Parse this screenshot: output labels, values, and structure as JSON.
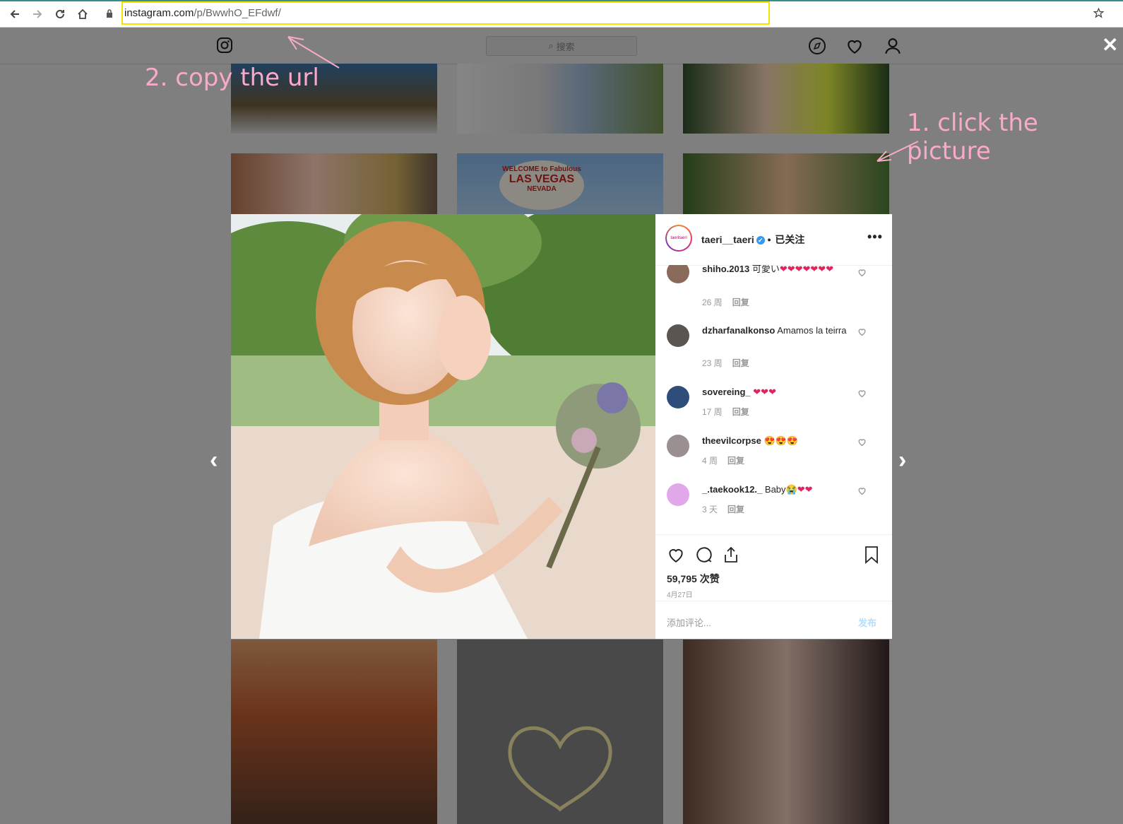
{
  "browser": {
    "url_host": "instagram.com",
    "url_path": "/p/BwwhO_EFdwf/",
    "nav_icons": [
      "back-icon",
      "forward-icon",
      "reload-icon",
      "home-icon",
      "lock-icon",
      "star-icon"
    ]
  },
  "instagram": {
    "search_placeholder": "搜索",
    "header_icons": [
      "instagram-logo",
      "explore-icon",
      "heart-icon",
      "profile-icon",
      "close-icon"
    ]
  },
  "post": {
    "username": "taeri__taeri",
    "follow_label": "已关注",
    "avatar_text": "taeritaeri",
    "comments": [
      {
        "user": "shiho.2013",
        "text": "可愛い",
        "emoji": "❤❤❤❤❤❤❤",
        "age": "26 周",
        "reply": "回复"
      },
      {
        "user": "dzharfanalkonso",
        "text": "Amamos la teirra",
        "emoji": "",
        "age": "23 周",
        "reply": "回复"
      },
      {
        "user": "sovereing_",
        "text": "",
        "emoji": "❤❤❤",
        "age": "17 周",
        "reply": "回复"
      },
      {
        "user": "theevilcorpse",
        "text": "",
        "emoji": "😍😍😍",
        "age": "4 周",
        "reply": "回复"
      },
      {
        "user": "_.taekook12._",
        "text": "Baby",
        "emoji": "😭❤❤",
        "age": "3 天",
        "reply": "回复"
      }
    ],
    "likes": "59,795 次赞",
    "date": "4月27日",
    "add_comment_placeholder": "添加评论...",
    "post_button": "发布"
  },
  "annotations": {
    "step2": "2. copy the url",
    "step1": "1. click the picture",
    "color": "#f9a9c9"
  },
  "grid_tiles_top": [
    "LAS VEGAS",
    "WELCOME to Fabulous",
    "NEVADA"
  ]
}
